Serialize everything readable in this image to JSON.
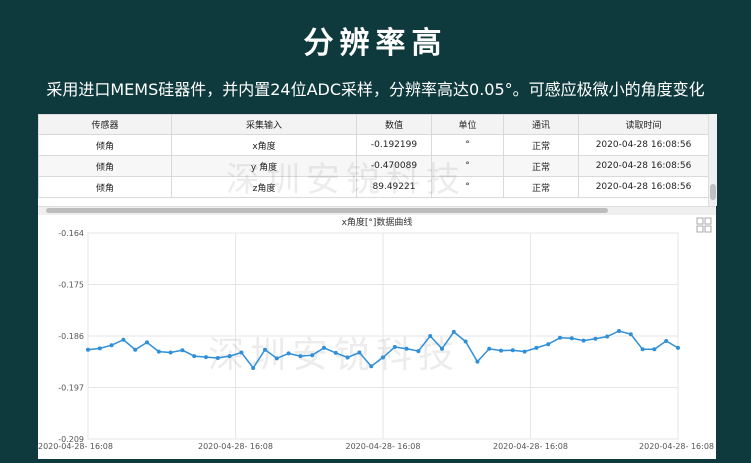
{
  "header": {
    "title": "分辨率高",
    "subtitle": "采用进口MEMS硅器件，并内置24位ADC采样，分辨率高达0.05°。可感应极微小的角度变化"
  },
  "table": {
    "columns": [
      "传感器",
      "采集输入",
      "数值",
      "单位",
      "通讯",
      "读取时间"
    ],
    "rows": [
      [
        "倾角",
        "x角度",
        "-0.192199",
        "°",
        "正常",
        "2020-04-28 16:08:56"
      ],
      [
        "倾角",
        "y 角度",
        "-0.470089",
        "°",
        "正常",
        "2020-04-28 16:08:56"
      ],
      [
        "倾角",
        "z角度",
        "89.49221",
        "°",
        "正常",
        "2020-04-28 16:08:56"
      ]
    ]
  },
  "watermark": "深圳安锐科技",
  "icons": {
    "expand": "grid-icon"
  },
  "colors": {
    "background": "#0f3a3d",
    "line": "#2f8fd8"
  },
  "chart_data": {
    "type": "line",
    "title": "x角度[°]数据曲线",
    "xlabel": "",
    "ylabel": "",
    "ylim": [
      -0.209,
      -0.164
    ],
    "yticks": [
      "-0.164",
      "-0.175",
      "-0.186",
      "-0.197",
      "-0.209"
    ],
    "xticks": [
      "2020-04-28- 16:08",
      "2020-04-28- 16:08",
      "2020-04-28- 16:08",
      "2020-04-28- 16:08",
      "2020-04-28- 16:08"
    ],
    "grid": true,
    "series": [
      {
        "values": [
          -0.1895,
          -0.1892,
          -0.1885,
          -0.1873,
          -0.1895,
          -0.1879,
          -0.1899,
          -0.1901,
          -0.1896,
          -0.1909,
          -0.1911,
          -0.1913,
          -0.1909,
          -0.1901,
          -0.1935,
          -0.1895,
          -0.1914,
          -0.1903,
          -0.1909,
          -0.1907,
          -0.1891,
          -0.1902,
          -0.1912,
          -0.1901,
          -0.1931,
          -0.1912,
          -0.1889,
          -0.1893,
          -0.1898,
          -0.1865,
          -0.1893,
          -0.1856,
          -0.1877,
          -0.1921,
          -0.1893,
          -0.1897,
          -0.1896,
          -0.1899,
          -0.1891,
          -0.1883,
          -0.1869,
          -0.187,
          -0.1875,
          -0.1871,
          -0.1866,
          -0.1854,
          -0.1861,
          -0.1894,
          -0.1894,
          -0.1876,
          -0.1891
        ]
      }
    ]
  }
}
